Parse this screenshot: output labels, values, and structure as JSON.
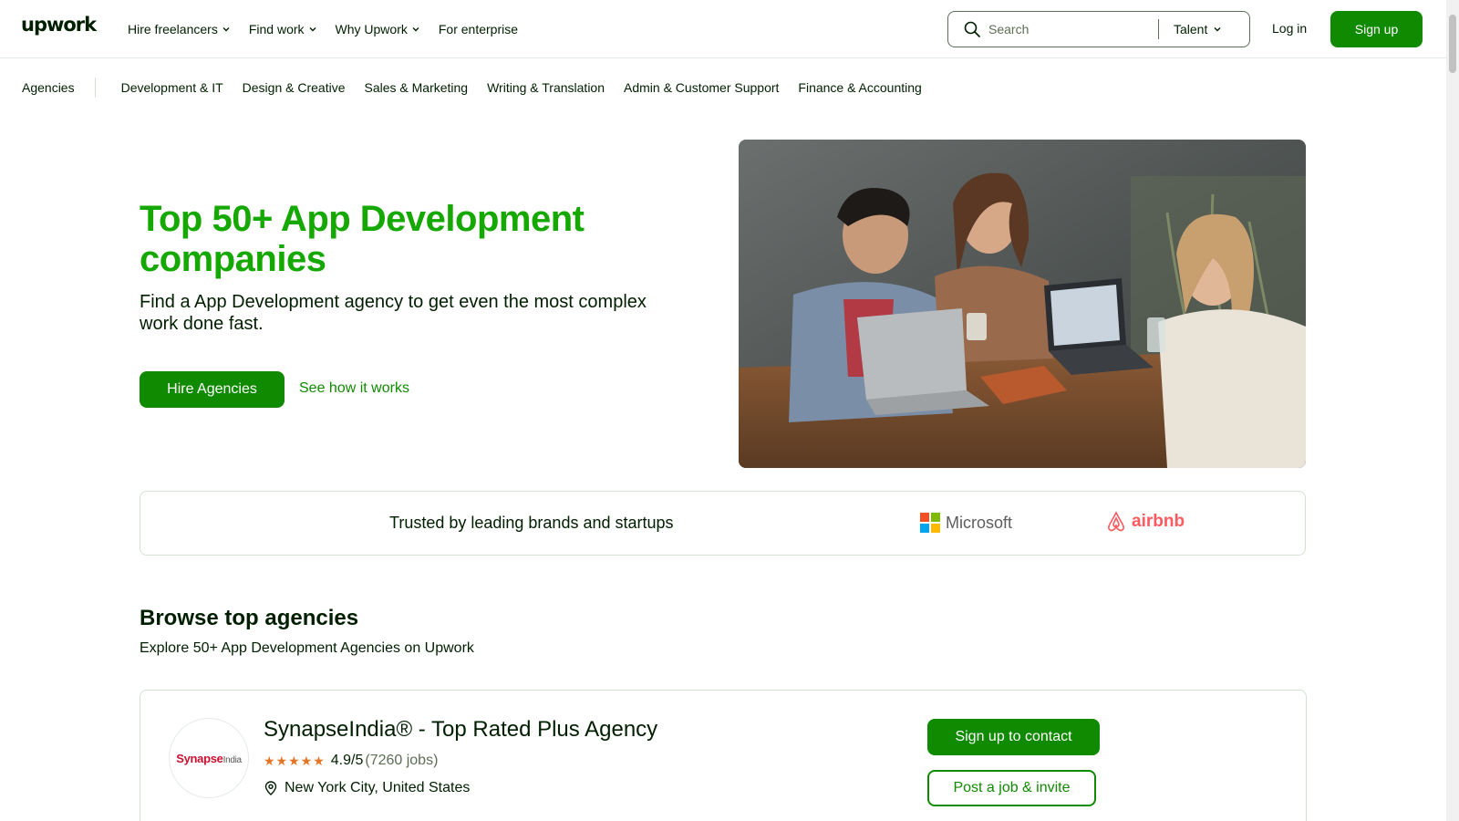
{
  "header": {
    "logo": "upwork",
    "nav": [
      {
        "label": "Hire freelancers",
        "dropdown": true
      },
      {
        "label": "Find work",
        "dropdown": true
      },
      {
        "label": "Why Upwork",
        "dropdown": true
      },
      {
        "label": "For enterprise",
        "dropdown": false
      }
    ],
    "search": {
      "placeholder": "Search",
      "scope": "Talent"
    },
    "login": "Log in",
    "signup": "Sign up"
  },
  "categories": {
    "agencies": "Agencies",
    "items": [
      "Development & IT",
      "Design & Creative",
      "Sales & Marketing",
      "Writing & Translation",
      "Admin & Customer Support",
      "Finance & Accounting"
    ]
  },
  "hero": {
    "title": "Top 50+ App Development companies",
    "subtitle": "Find a App Development agency to get even the most complex work done fast.",
    "primary_cta": "Hire Agencies",
    "secondary_cta": "See how it works"
  },
  "trusted": {
    "text": "Trusted by leading brands and startups",
    "brands": [
      "Microsoft",
      "airbnb"
    ]
  },
  "browse": {
    "title": "Browse top agencies",
    "subtitle": "Explore 50+ App Development Agencies on Upwork"
  },
  "agency": {
    "logo_text": "Synapse",
    "logo_text_suffix": "India",
    "name": "SynapseIndia® - Top Rated Plus Agency",
    "stars": "★★★★★",
    "rating": "4.9/5",
    "jobs": "(7260 jobs)",
    "location": "New York City, United States",
    "contact_cta": "Sign up to contact",
    "post_cta": "Post a job & invite"
  },
  "colors": {
    "brand_green": "#108a00",
    "title_green": "#14a800",
    "star": "#e57524"
  }
}
